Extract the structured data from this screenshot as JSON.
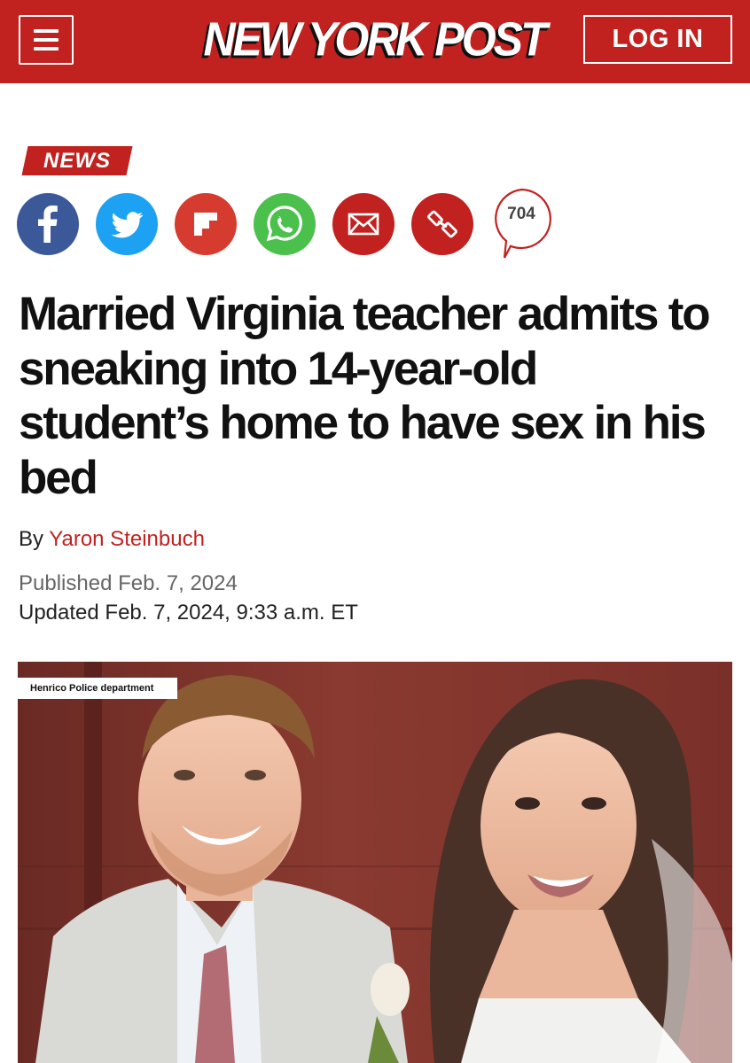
{
  "header": {
    "logo_text": "NEW YORK POST",
    "login_label": "LOG IN",
    "accent_color": "#c1221f"
  },
  "article": {
    "section": "NEWS",
    "share": {
      "icons": [
        "facebook-icon",
        "twitter-icon",
        "flipboard-icon",
        "whatsapp-icon",
        "email-icon",
        "link-icon",
        "comments-icon"
      ],
      "comment_count": "704"
    },
    "headline": "Married Virginia teacher admits to sneaking into 14-year-old student’s home to have sex in his bed",
    "byline_prefix": "By",
    "author": "Yaron Steinbuch",
    "published": "Published Feb. 7, 2024",
    "updated": "Updated Feb. 7, 2024, 9:33 a.m. ET",
    "photo_credit": "Henrico Police department"
  }
}
